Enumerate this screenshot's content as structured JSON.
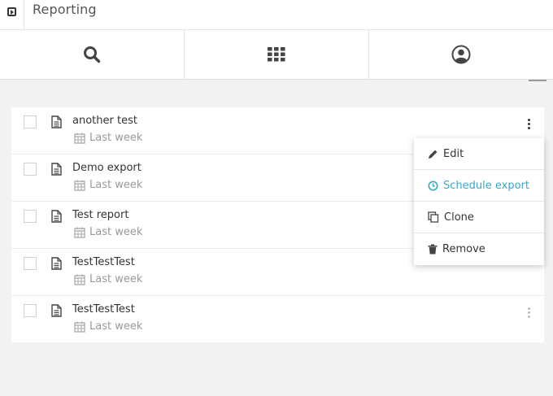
{
  "app": {
    "title": "Reporting"
  },
  "nav": {
    "tabs": [
      {
        "icon": "search-icon"
      },
      {
        "icon": "grid-icon"
      },
      {
        "icon": "user-icon"
      }
    ]
  },
  "reports": [
    {
      "name": "another test",
      "date": "Last week"
    },
    {
      "name": "Demo export",
      "date": "Last week"
    },
    {
      "name": "Test report",
      "date": "Last week"
    },
    {
      "name": "TestTestTest",
      "date": "Last week"
    },
    {
      "name": "TestTestTest",
      "date": "Last week"
    }
  ],
  "context_menu": {
    "items": [
      {
        "label": "Edit",
        "icon": "pencil-icon"
      },
      {
        "label": "Schedule export",
        "icon": "clock-icon"
      },
      {
        "label": "Clone",
        "icon": "copy-icon"
      },
      {
        "label": "Remove",
        "icon": "trash-icon"
      }
    ],
    "active_color": "#3aa8c1"
  }
}
